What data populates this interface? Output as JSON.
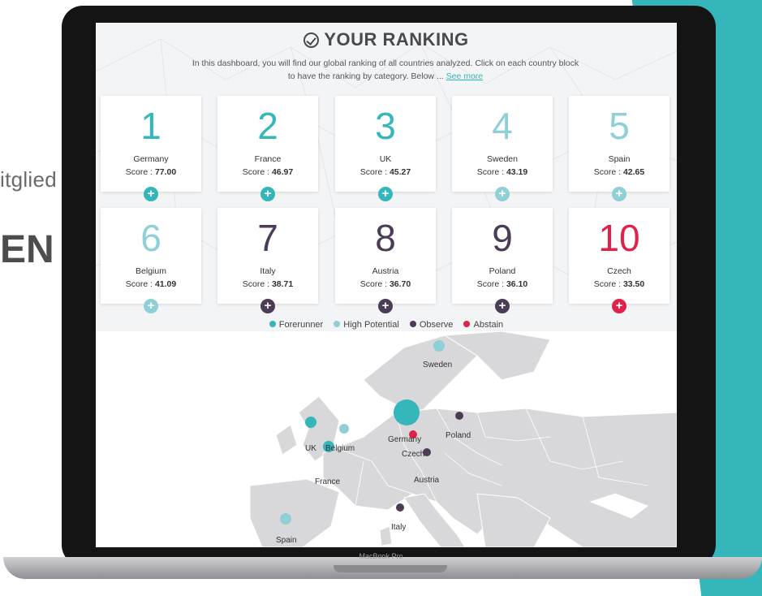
{
  "background": {
    "text_a": "itglied",
    "text_b": "EN"
  },
  "laptop": {
    "label": "MacBook Pro"
  },
  "dashboard": {
    "title": "YOUR RANKING",
    "intro": "In this dashboard, you will find our global ranking of all countries analyzed. Click on each country block to have the ranking by category. Below ...",
    "see_more": "See more",
    "score_label": "Score :"
  },
  "cards": [
    {
      "rank": "1",
      "country": "Germany",
      "score": "77.00",
      "category": "Forerunner"
    },
    {
      "rank": "2",
      "country": "France",
      "score": "46.97",
      "category": "Forerunner"
    },
    {
      "rank": "3",
      "country": "UK",
      "score": "45.27",
      "category": "Forerunner"
    },
    {
      "rank": "4",
      "country": "Sweden",
      "score": "43.19",
      "category": "High Potential"
    },
    {
      "rank": "5",
      "country": "Spain",
      "score": "42.65",
      "category": "High Potential"
    },
    {
      "rank": "6",
      "country": "Belgium",
      "score": "41.09",
      "category": "High Potential"
    },
    {
      "rank": "7",
      "country": "Italy",
      "score": "38.71",
      "category": "Observe"
    },
    {
      "rank": "8",
      "country": "Austria",
      "score": "36.70",
      "category": "Observe"
    },
    {
      "rank": "9",
      "country": "Poland",
      "score": "36.10",
      "category": "Observe"
    },
    {
      "rank": "10",
      "country": "Czech",
      "score": "33.50",
      "category": "Abstain"
    }
  ],
  "legend": [
    {
      "label": "Forerunner",
      "color": "#35b6bb"
    },
    {
      "label": "High Potential",
      "color": "#8fcfd6"
    },
    {
      "label": "Observe",
      "color": "#4a3d55"
    },
    {
      "label": "Abstain",
      "color": "#e0224b"
    }
  ],
  "map": {
    "labels": {
      "sweden": "Sweden",
      "germany": "Germany",
      "poland": "Poland",
      "uk": "UK",
      "belgium": "Belgium",
      "czech": "Czech",
      "france": "France",
      "austria": "Austria",
      "italy": "Italy",
      "spain": "Spain"
    }
  },
  "icons": {
    "title": "check-circle-icon",
    "card_button": "plus-circle-icon"
  }
}
